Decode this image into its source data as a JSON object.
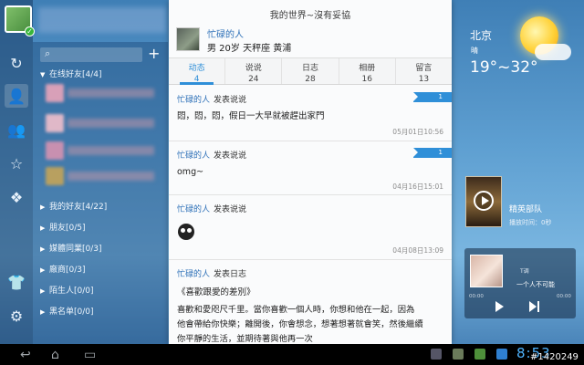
{
  "main": {
    "title": "我的世界~沒有妥協",
    "profile": {
      "name": "忙碌的人",
      "info": "男 20岁 天秤座 黄浦"
    },
    "tabs": [
      {
        "label": "动态",
        "count": "4"
      },
      {
        "label": "说说",
        "count": "24"
      },
      {
        "label": "日志",
        "count": "28"
      },
      {
        "label": "相册",
        "count": "16"
      },
      {
        "label": "留言",
        "count": "13"
      }
    ],
    "posts": [
      {
        "author": "忙碌的人",
        "action": "发表说说",
        "body": "悶，悶，悶，假日一大早就被趕出家門",
        "badge": "1",
        "time": "05月01日10:56"
      },
      {
        "author": "忙碌的人",
        "action": "发表说说",
        "body": "omg~",
        "badge": "1",
        "time": "04月16日15:01"
      },
      {
        "author": "忙碌的人",
        "action": "发表说说",
        "body": "",
        "time": "04月08日13:09"
      },
      {
        "author": "忙碌的人",
        "action": "发表日志",
        "body": "《喜歡跟愛的差別》",
        "body2": "喜歡和愛咫尺千里。當你喜歡一個人時，你想和他在一起，因為",
        "body3": "他會帶給你快樂；離開後，你會想念，想著想著就會笑，然後繼續",
        "body4": "你平靜的生活，並期待著與他再一次"
      }
    ]
  },
  "sidebar": {
    "groups": [
      {
        "label": "在线好友[4/4]"
      },
      {
        "label": "我的好友[4/22]"
      },
      {
        "label": "朋友[0/5]"
      },
      {
        "label": "媒體同業[0/3]"
      },
      {
        "label": "廠商[0/3]"
      },
      {
        "label": "陌生人[0/0]"
      },
      {
        "label": "黑名单[0/0]"
      }
    ]
  },
  "weather": {
    "city": "北京",
    "condition": "晴",
    "temp": "19°~32°"
  },
  "video": {
    "title": "精英部队",
    "time": "播放时间：0秒"
  },
  "music": {
    "title": "T调",
    "subtitle": "一个人不可能",
    "time_start": "00:00",
    "time_end": "00:00"
  },
  "system": {
    "clock": "8:53",
    "watermark": "#1420249"
  },
  "colors": {
    "accent": "#2f8fd8",
    "name_link": "#2f71b8",
    "online_badge": "#38b53a"
  }
}
